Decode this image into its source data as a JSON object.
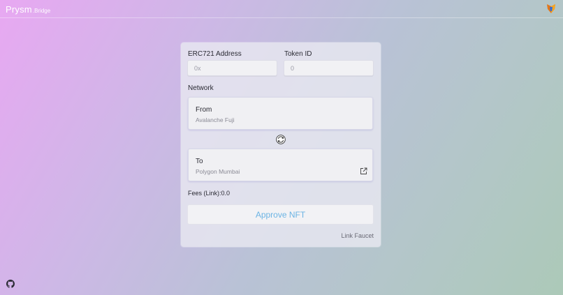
{
  "header": {
    "brand": "Prysm",
    "brand_suffix": ".Bridge",
    "wallet_icon": "metamask-fox-icon"
  },
  "form": {
    "address": {
      "label": "ERC721 Address",
      "placeholder": "0x",
      "value": ""
    },
    "token": {
      "label": "Token ID",
      "placeholder": "0",
      "value": ""
    },
    "network_label": "Network",
    "from": {
      "label": "From",
      "network": "Avalanche Fuji"
    },
    "swap_icon": "swap-icon",
    "to": {
      "label": "To",
      "network": "Polygon Mumbai",
      "icon": "external-link-icon"
    },
    "fees": "Fees (Link):0.0",
    "approve_button": "Approve NFT",
    "faucet_link": "Link Faucet"
  },
  "footer": {
    "icon": "github-icon"
  },
  "colors": {
    "accent": "#6cb4e4",
    "card": "#e8e8f0"
  }
}
